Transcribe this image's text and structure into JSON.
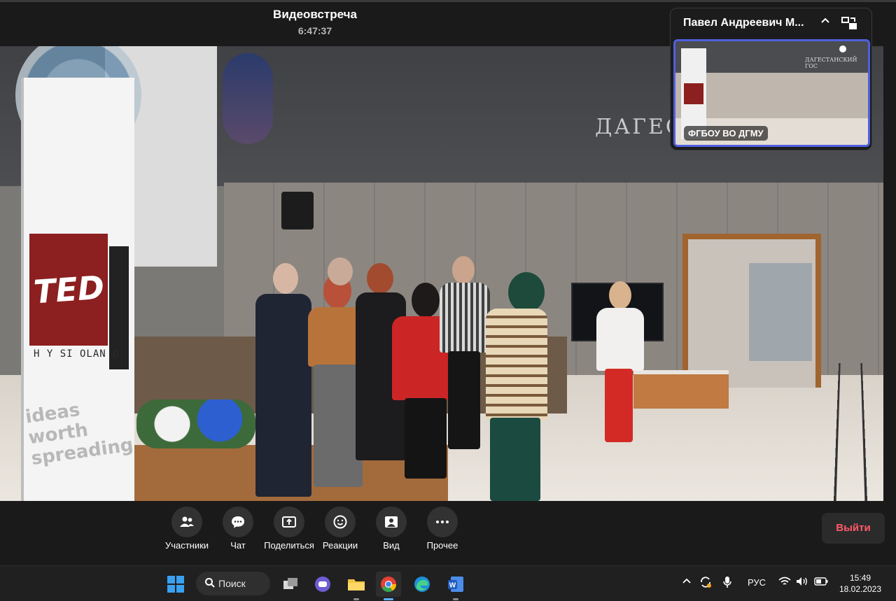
{
  "meeting": {
    "title": "Видеовстреча",
    "timer": "6:47:37"
  },
  "self_view": {
    "name": "Павел Андреевич М...",
    "label": "ФГБОУ ВО ДГМУ",
    "sign": "ДАГЕСТАНСКИЙ ГОС"
  },
  "video": {
    "sign_text": "ДАГЕС",
    "banner": {
      "logo": "TED",
      "sub": "H Y SI OLAN D",
      "tagline": "ideas worth spreading"
    }
  },
  "toolbar": {
    "items": [
      {
        "label": "Участники",
        "icon": "participants-icon"
      },
      {
        "label": "Чат",
        "icon": "chat-icon"
      },
      {
        "label": "Поделиться",
        "icon": "share-screen-icon"
      },
      {
        "label": "Реакции",
        "icon": "reactions-icon"
      },
      {
        "label": "Вид",
        "icon": "view-icon"
      },
      {
        "label": "Прочее",
        "icon": "more-icon"
      }
    ],
    "leave_label": "Выйти"
  },
  "taskbar": {
    "search_label": "Поиск",
    "apps": [
      "start-icon",
      "task-view-icon",
      "teams-chat-icon",
      "file-explorer-icon",
      "chrome-icon",
      "edge-icon",
      "word-icon"
    ],
    "language": "РУС",
    "time": "15:49",
    "date": "18.02.2023"
  },
  "colors": {
    "accent": "#4f5fdf",
    "leave": "#ff5a6a",
    "ted_red": "#8c1f1f"
  }
}
